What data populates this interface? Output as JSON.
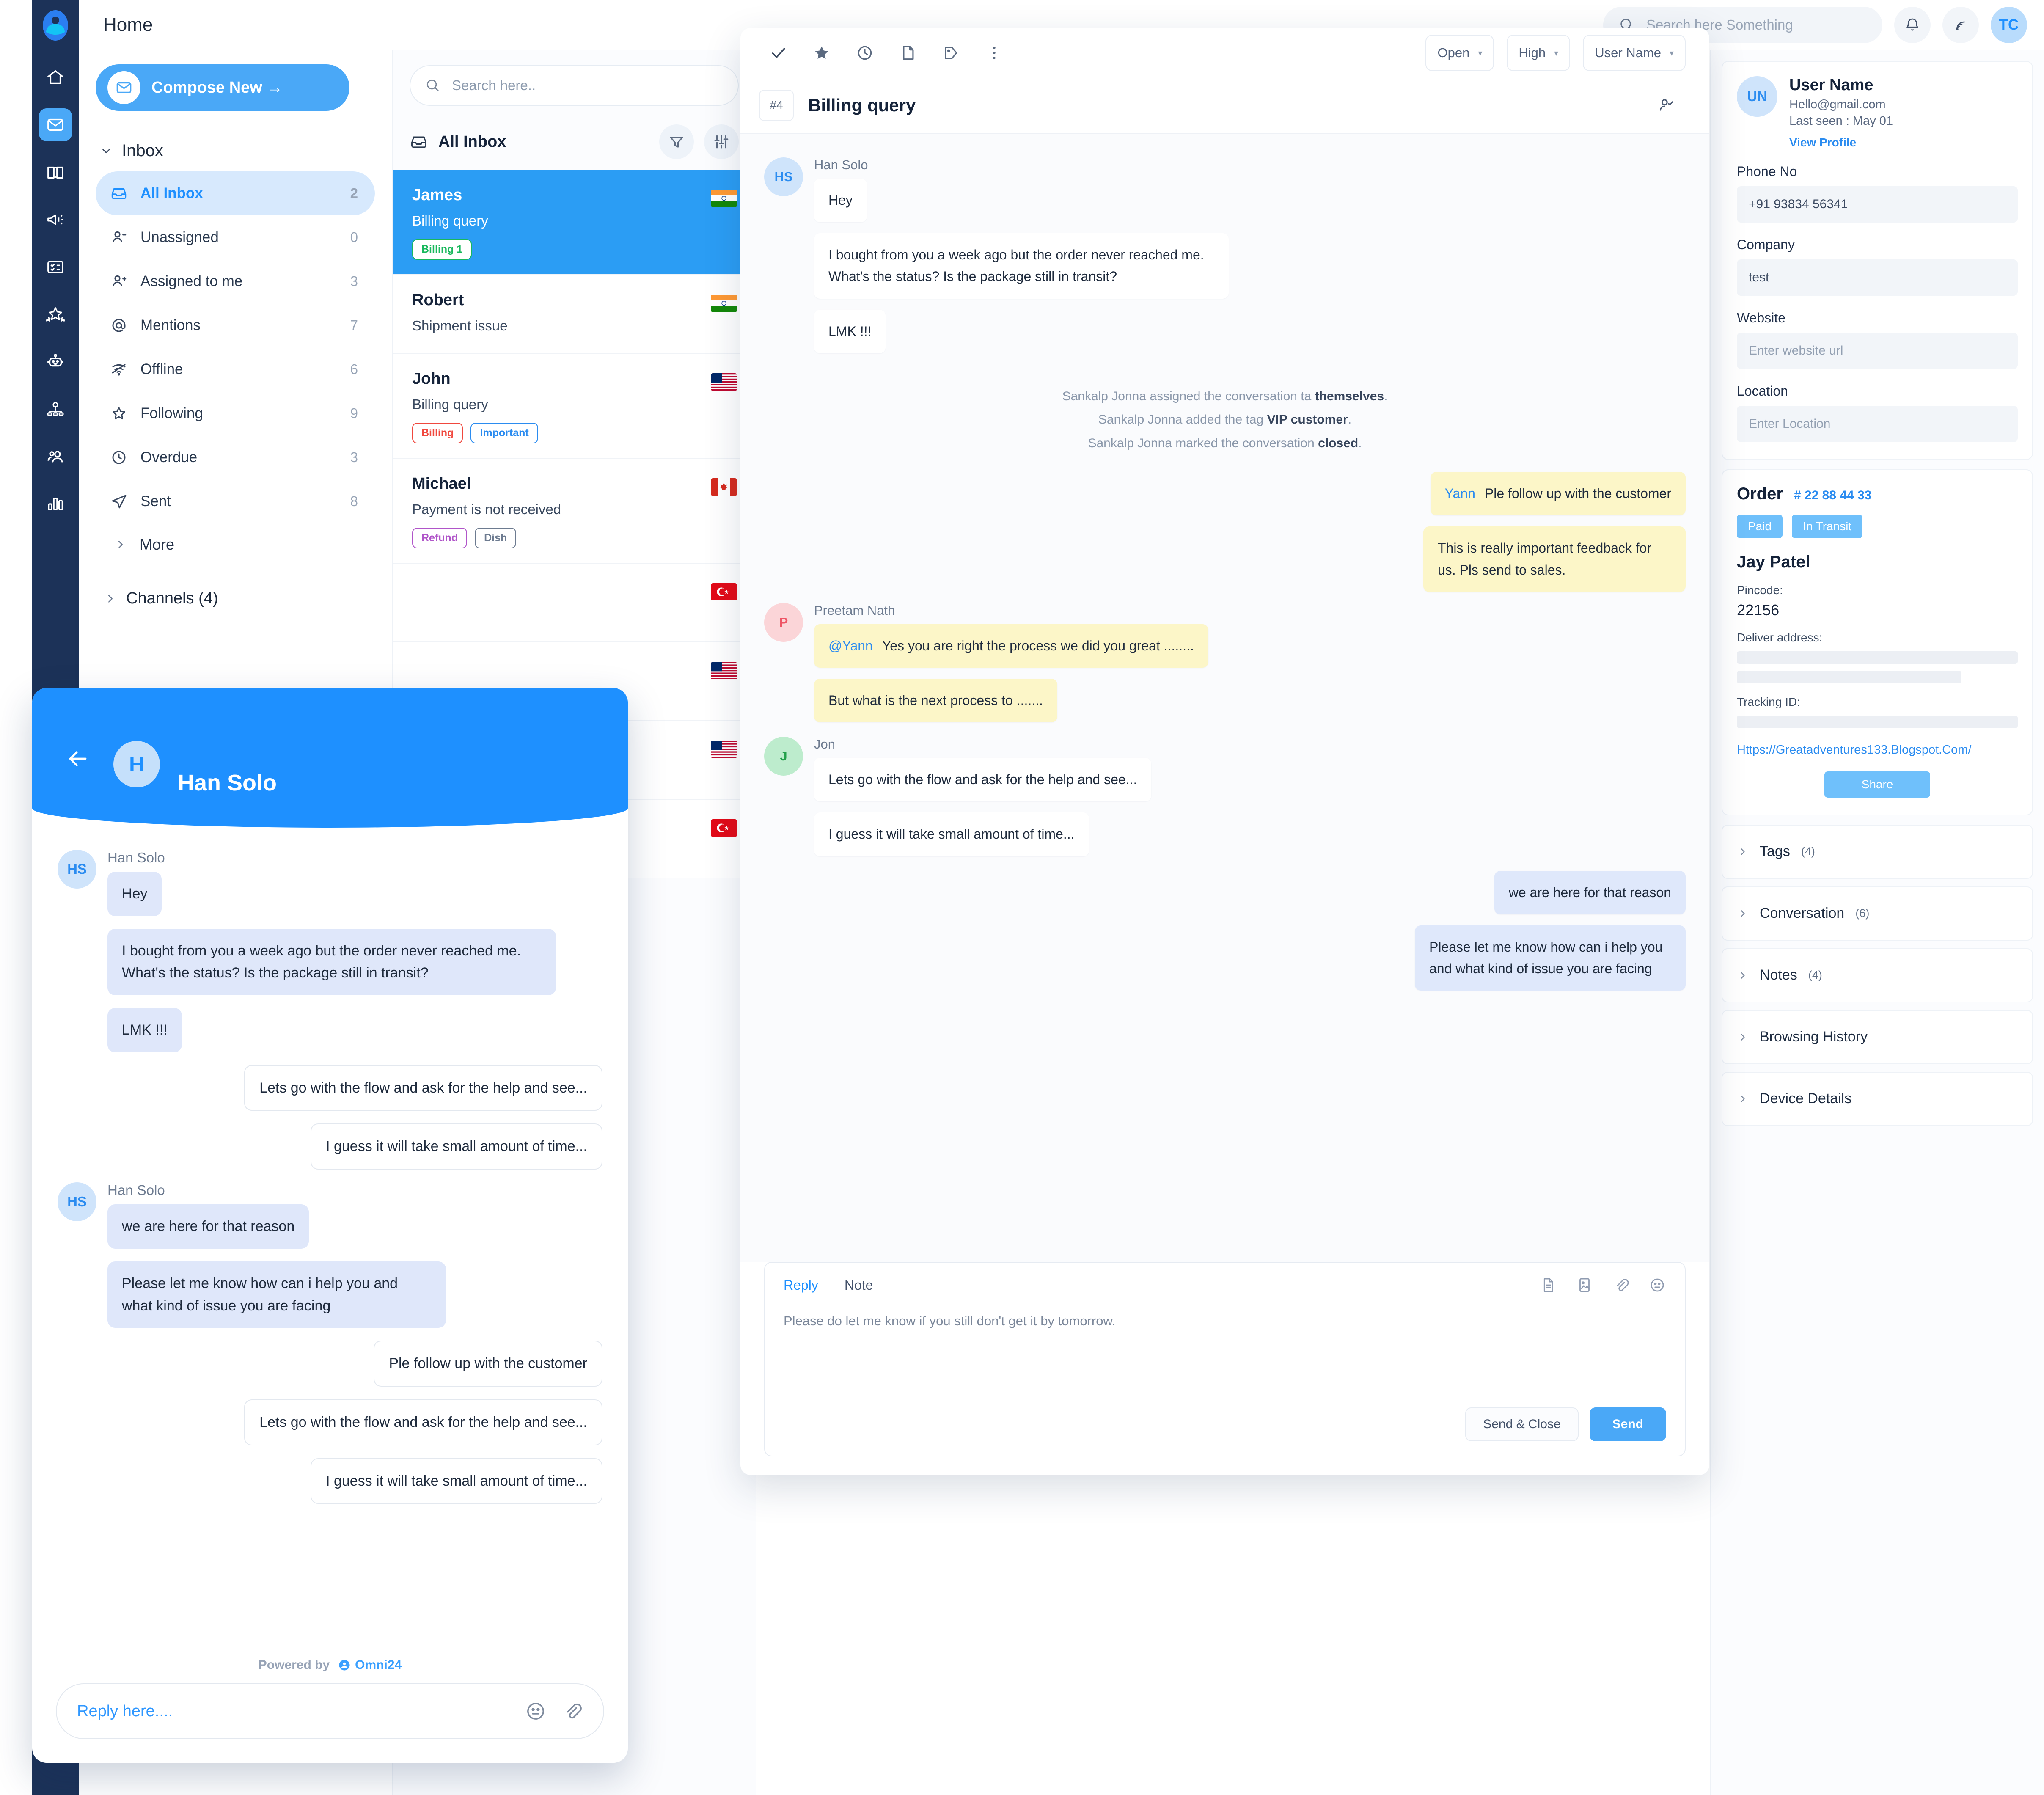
{
  "topbar": {
    "title": "Home",
    "search_placeholder": "Search here Something",
    "avatar_initials": "TC"
  },
  "rail": {
    "items": [
      {
        "name": "home-icon",
        "label": "Home"
      },
      {
        "name": "inbox-icon",
        "label": "Inbox"
      },
      {
        "name": "knowledge-base-icon",
        "label": "Knowledge Base"
      },
      {
        "name": "campaign-icon",
        "label": "Campaigns"
      },
      {
        "name": "tasks-icon",
        "label": "Tasks"
      },
      {
        "name": "rating-icon",
        "label": "Ratings"
      },
      {
        "name": "bot-icon",
        "label": "Bots"
      },
      {
        "name": "automation-icon",
        "label": "Automation"
      },
      {
        "name": "contacts-icon",
        "label": "Contacts"
      },
      {
        "name": "reports-icon",
        "label": "Reports"
      }
    ]
  },
  "sidebar": {
    "compose_label": "Compose New  →",
    "group_label": "Inbox",
    "items": [
      {
        "label": "All Inbox",
        "count": "2",
        "icon": "inbox-icon",
        "active": true
      },
      {
        "label": "Unassigned",
        "count": "0",
        "icon": "user-minus-icon",
        "active": false
      },
      {
        "label": "Assigned to me",
        "count": "3",
        "icon": "user-plus-icon",
        "active": false
      },
      {
        "label": "Mentions",
        "count": "7",
        "icon": "at-icon",
        "active": false
      },
      {
        "label": "Offline",
        "count": "6",
        "icon": "wifi-off-icon",
        "active": false
      },
      {
        "label": "Following",
        "count": "9",
        "icon": "star-icon",
        "active": false
      },
      {
        "label": "Overdue",
        "count": "3",
        "icon": "clock-icon",
        "active": false
      },
      {
        "label": "Sent",
        "count": "8",
        "icon": "send-icon",
        "active": false
      }
    ],
    "more_label": "More",
    "channels_label": "Channels (4)"
  },
  "conversation_list": {
    "search_placeholder": "Search here..",
    "header": "All Inbox",
    "items": [
      {
        "name": "James",
        "subject": "Billing query",
        "selected": true,
        "flag": "in",
        "tags": [
          {
            "text": "Billing 1",
            "color": "#18b85c"
          }
        ]
      },
      {
        "name": "Robert",
        "subject": "Shipment issue",
        "selected": false,
        "flag": "in",
        "tags": []
      },
      {
        "name": "John",
        "subject": "Billing query",
        "selected": false,
        "flag": "us",
        "tags": [
          {
            "text": "Billing",
            "color": "#f0483e"
          },
          {
            "text": "Important",
            "color": "#2b8cf0"
          }
        ]
      },
      {
        "name": "Michael",
        "subject": "Payment is not received",
        "selected": false,
        "flag": "ca",
        "tags": [
          {
            "text": "Refund",
            "color": "#b055c9"
          },
          {
            "text": "Dish",
            "color": "#6d7b90"
          }
        ]
      }
    ]
  },
  "conversation": {
    "toolbar_icons": [
      "check-icon",
      "star-icon",
      "clock-icon",
      "folder-icon",
      "tag-icon",
      "more-vertical-icon"
    ],
    "status_select": "Open",
    "priority_select": "High",
    "assignee_select": "User Name",
    "ticket_number": "#4",
    "subject": "Billing query",
    "messages": [
      {
        "type": "incoming",
        "author": "Han Solo",
        "avatar": "HS",
        "avatar_color": "blue",
        "texts": [
          "Hey",
          "I bought from you a week ago but the order never reached me. What's the status? Is the package still in transit?",
          "LMK !!!"
        ]
      },
      {
        "type": "system",
        "lines": [
          {
            "pre": "Sankalp Jonna assigned the conversation ta ",
            "strong": "themselves",
            "post": "."
          },
          {
            "pre": "Sankalp Jonna added the tag ",
            "strong": "VIP customer",
            "post": "."
          },
          {
            "pre": "Sankalp Jonna marked the conversation ",
            "strong": "closed",
            "post": "."
          }
        ]
      },
      {
        "type": "note-right",
        "mention": "Yann",
        "text": "Ple follow up with the customer"
      },
      {
        "type": "note-right",
        "mention": "",
        "text": "This is really important feedback for us. Pls send to sales."
      },
      {
        "type": "note-left",
        "author": "Preetam Nath",
        "avatar": "P",
        "avatar_color": "pink",
        "mention": "@Yann",
        "text": "Yes you are right the process we did you great ........"
      },
      {
        "type": "note-left-cont",
        "text": "But what is the next process to ......."
      },
      {
        "type": "incoming",
        "author": "Jon",
        "avatar": "J",
        "avatar_color": "green",
        "texts": [
          "Lets go with the flow and ask for the help and see...",
          "I guess it will take small amount of time..."
        ]
      },
      {
        "type": "outgoing",
        "texts": [
          "we are here for that reason",
          "Please let me know how can i help you and what kind of issue you are facing"
        ]
      }
    ],
    "editor": {
      "tab_reply": "Reply",
      "tab_note": "Note",
      "tools": [
        "document-icon",
        "image-icon",
        "attachment-icon",
        "emoji-icon"
      ],
      "body_text": "Please do let me know if you still don't get it by tomorrow.",
      "send_close_label": "Send & Close",
      "send_label": "Send"
    }
  },
  "details": {
    "user": {
      "avatar": "UN",
      "name": "User Name",
      "email": "Hello@gmail.com",
      "last_seen": "Last seen : May 01",
      "view_profile": "View Profile",
      "fields": [
        {
          "label": "Phone No",
          "value": "+91 93834 56341",
          "placeholder": false
        },
        {
          "label": "Company",
          "value": "test",
          "placeholder": false
        },
        {
          "label": "Website",
          "value": "Enter website url",
          "placeholder": true
        },
        {
          "label": "Location",
          "value": "Enter Location",
          "placeholder": true
        }
      ]
    },
    "order": {
      "title": "Order",
      "number": "# 22 88 44 33",
      "badges": [
        "Paid",
        "In Transit"
      ],
      "customer": "Jay Patel",
      "pincode_label": "Pincode:",
      "pincode": "22156",
      "address_label": "Deliver address:",
      "tracking_label": "Tracking ID:",
      "link": "Https://Greatadventures133.Blogspot.Com/",
      "share_label": "Share"
    },
    "accordions": [
      {
        "label": "Tags",
        "count": "(4)"
      },
      {
        "label": "Conversation",
        "count": "(6)"
      },
      {
        "label": "Notes",
        "count": "(4)"
      },
      {
        "label": "Browsing History",
        "count": ""
      },
      {
        "label": "Device Details",
        "count": ""
      }
    ]
  },
  "widget": {
    "header_name": "Han Solo",
    "header_avatar": "H",
    "messages": [
      {
        "side": "in",
        "author": "Han Solo",
        "avatar": "HS",
        "texts": [
          "Hey",
          "I bought from you a week ago but the order never reached me. What's the status? Is the package still in transit?",
          "LMK !!!"
        ]
      },
      {
        "side": "out",
        "texts": [
          "Lets go with the flow and ask for the help and see...",
          "I guess it will take small amount of time..."
        ]
      },
      {
        "side": "in",
        "author": "Han Solo",
        "avatar": "HS",
        "texts": [
          "we are here for that reason",
          "Please let me know how can i help you and what kind of issue you are facing"
        ]
      },
      {
        "side": "out",
        "texts": [
          "Ple follow up with the customer",
          "Lets go with the flow and ask for the help and see...",
          "I guess it will take small amount of time..."
        ]
      }
    ],
    "powered_by": "Powered by",
    "brand": "Omni24",
    "input_placeholder": "Reply here...."
  },
  "colors": {
    "brand_blue": "#1e90ff",
    "light_blue": "#4aa8f7",
    "navy": "#1c3258",
    "note_yellow": "#fcf6c8",
    "bubble_lavender": "#dfe8fb"
  }
}
